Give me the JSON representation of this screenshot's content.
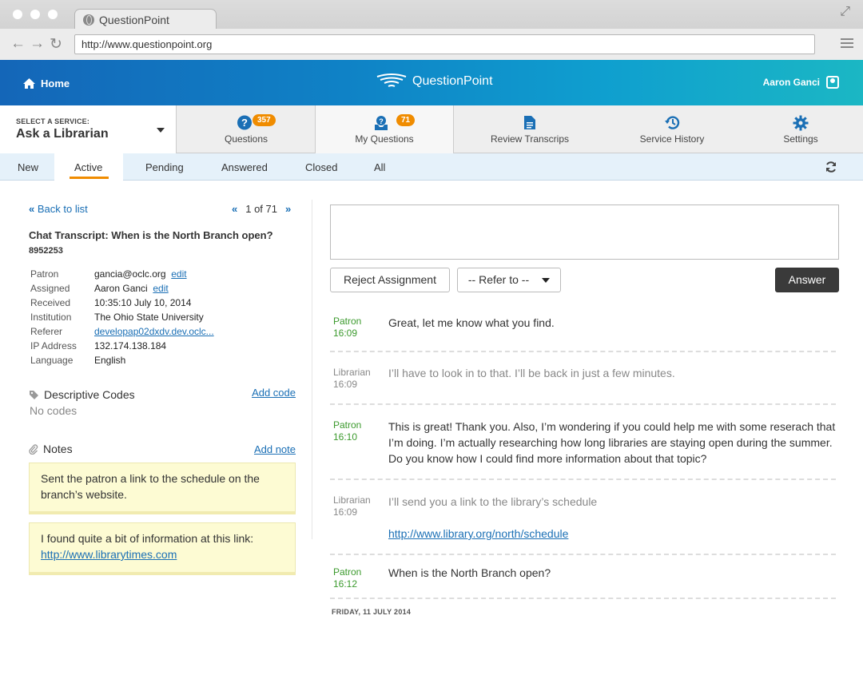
{
  "browser": {
    "tab_title": "QuestionPoint",
    "url": "http://www.questionpoint.org"
  },
  "header": {
    "home_label": "Home",
    "logo_text": "QuestionPoint",
    "user_name": "Aaron Ganci"
  },
  "service": {
    "label": "SELECT A SERVICE:",
    "name": "Ask a Librarian"
  },
  "nav": {
    "questions": {
      "label": "Questions",
      "count": "357"
    },
    "my_questions": {
      "label": "My Questions",
      "count": "71"
    },
    "review": {
      "label": "Review Transcrips"
    },
    "history": {
      "label": "Service History"
    },
    "settings": {
      "label": "Settings"
    }
  },
  "subtabs": [
    "New",
    "Active",
    "Pending",
    "Answered",
    "Closed",
    "All"
  ],
  "detail": {
    "back_label": "Back to list",
    "pager": "1 of 71",
    "title": "Chat Transcript: When is the North Branch open?",
    "id": "8952253",
    "fields": {
      "patron_k": "Patron",
      "patron_v": "gancia@oclc.org",
      "patron_edit": "edit",
      "assigned_k": "Assigned",
      "assigned_v": "Aaron Ganci",
      "assigned_edit": "edit",
      "received_k": "Received",
      "received_v": "10:35:10 July 10, 2014",
      "institution_k": "Institution",
      "institution_v": "The Ohio State University",
      "referer_k": "Referer",
      "referer_v": "developap02dxdv.dev.oclc...",
      "ip_k": "IP Address",
      "ip_v": "132.174.138.184",
      "language_k": "Language",
      "language_v": "English"
    },
    "codes_title": "Descriptive Codes",
    "add_code": "Add code",
    "no_codes": "No codes",
    "notes_title": "Notes",
    "add_note": "Add note",
    "note1": "Sent the patron a link to the schedule on the branch’s website.",
    "note2_text": "I found quite a bit of information at this link:",
    "note2_link": "http://www.librarytimes.com"
  },
  "actions": {
    "reject": "Reject Assignment",
    "refer": "-- Refer to --",
    "answer": "Answer"
  },
  "messages": [
    {
      "who": "Patron",
      "time": "16:09",
      "text": "Great, let me know what you find."
    },
    {
      "who": "Librarian",
      "time": "16:09",
      "text": "I’ll have to look in to that. I’ll be back in just a few minutes."
    },
    {
      "who": "Patron",
      "time": "16:10",
      "text": "This is great! Thank you. Also, I’m wondering if you could help me with some reserach that I’m doing. I’m actually researching how long libraries are staying open during the summer. Do you know how I could find more information about that topic?"
    },
    {
      "who": "Librarian",
      "time": "16:09",
      "text": "I’ll send you a link to the library’s schedule",
      "link": "http://www.library.org/north/schedule"
    },
    {
      "who": "Patron",
      "time": "16:12",
      "text": "When is the North Branch open?"
    }
  ],
  "date_footer": "FRIDAY, 11 JULY 2014",
  "colors": {
    "accent": "#f08c00",
    "link": "#1a6fb5",
    "patron": "#3b9a2d",
    "header_start": "#1466b8",
    "header_end": "#1bb7c4"
  }
}
